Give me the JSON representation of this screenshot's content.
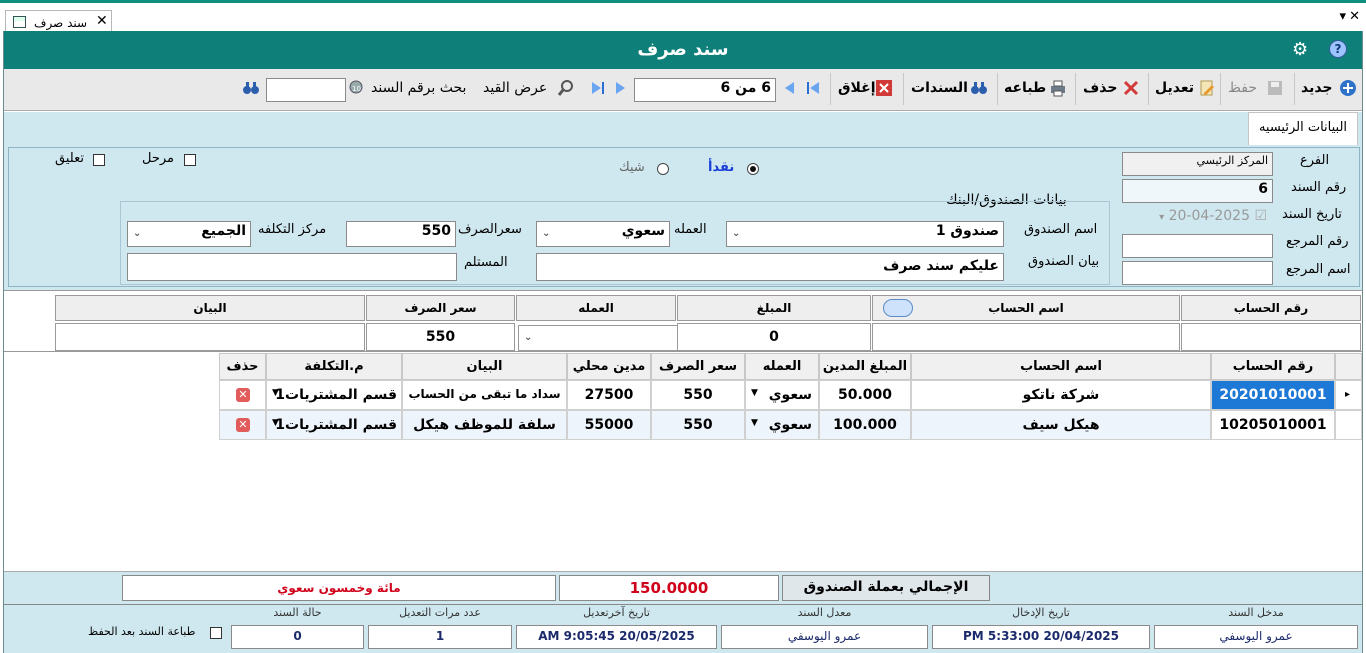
{
  "window": {
    "tab_title": "سند صرف",
    "close": "✕"
  },
  "header": {
    "title": "سند صرف"
  },
  "toolbar": {
    "new": "جديد",
    "save": "حفظ",
    "edit": "تعديل",
    "delete": "حذف",
    "print": "طباعه",
    "vouchers": "السندات",
    "close": "إغلاق",
    "record_pos": "6 من 6",
    "view_entry": "عرض القيد",
    "search_label": "بحث برقم السند",
    "search_value": ""
  },
  "tab": {
    "label": "البيانات الرئيسيه"
  },
  "main": {
    "branch_label": "الفرع",
    "branch": "المركز الرئيسي",
    "voucher_no_label": "رقم السند",
    "voucher_no": "6",
    "voucher_date_label": "تاريخ السند",
    "voucher_date": "20-04-2025",
    "ref_no_label": "رقم المرجع",
    "ref_no": "",
    "ref_name_label": "اسم المرجع",
    "ref_name": "",
    "cash": "نقدأ",
    "cheque": "شيك",
    "posted": "مرحل",
    "suspended": "تعليق",
    "cashbox_group": "بيانات الصندوق/البنك",
    "cashbox_name_label": "اسم الصندوق",
    "cashbox_name": "صندوق 1",
    "currency_label": "العمله",
    "currency": "سعوي",
    "rate_label": "سعرالصرف",
    "rate": "550",
    "cost_center_label": "مركز التكلفه",
    "cost_center": "الجميع",
    "cashbox_desc_label": "بيان الصندوق",
    "cashbox_desc": "عليكم سند صرف",
    "receiver_label": "المستلم",
    "receiver": ""
  },
  "entry": {
    "headers": [
      "رقم الحساب",
      "اسم الحساب",
      "المبلغ",
      "العمله",
      "سعر الصرف",
      "البيان"
    ],
    "amount": "0",
    "rate": "550"
  },
  "grid": {
    "headers": [
      "رقم الحساب",
      "اسم الحساب",
      "المبلغ المدين",
      "العمله",
      "سعر الصرف",
      "مدين محلي",
      "البيان",
      "م.التكلفة",
      "حذف"
    ],
    "rows": [
      {
        "acct": "20201010001",
        "name": "شركة ناتكو",
        "amount": "50.000",
        "currency": "سعوي",
        "rate": "550",
        "local": "27500",
        "desc": "سداد ما تبقى من الحساب",
        "cost": "قسم المشتريات1"
      },
      {
        "acct": "10205010001",
        "name": "هيكل سيف",
        "amount": "100.000",
        "currency": "سعوي",
        "rate": "550",
        "local": "55000",
        "desc": "سلفة للموظف هيكل",
        "cost": "قسم المشتريات1"
      }
    ]
  },
  "totals": {
    "label": "الإجمالي بعملة الصندوق",
    "amount": "150.0000",
    "words": "مائة وخمسون سعوي"
  },
  "footer": {
    "entered_by_label": "مدخل السند",
    "entered_by": "عمرو اليوسفي",
    "entry_date_label": "تاريخ الإدخال",
    "entry_date": "PM 5:33:00 20/04/2025",
    "modified_by_label": "معدل السند",
    "modified_by": "عمرو اليوسفي",
    "last_mod_label": "تاريخ آخرتعديل",
    "last_mod": "AM 9:05:45 20/05/2025",
    "mod_count_label": "عدد مرات التعديل",
    "mod_count": "1",
    "status_label": "حالة السند",
    "status": "0",
    "print_after_save": "طباعة السند بعد الحفظ"
  },
  "colors": {
    "title_bg": "#0f7f79",
    "panel_bg": "#cfe8f0",
    "selected": "#1e78d6",
    "total_red": "#d0021b"
  }
}
